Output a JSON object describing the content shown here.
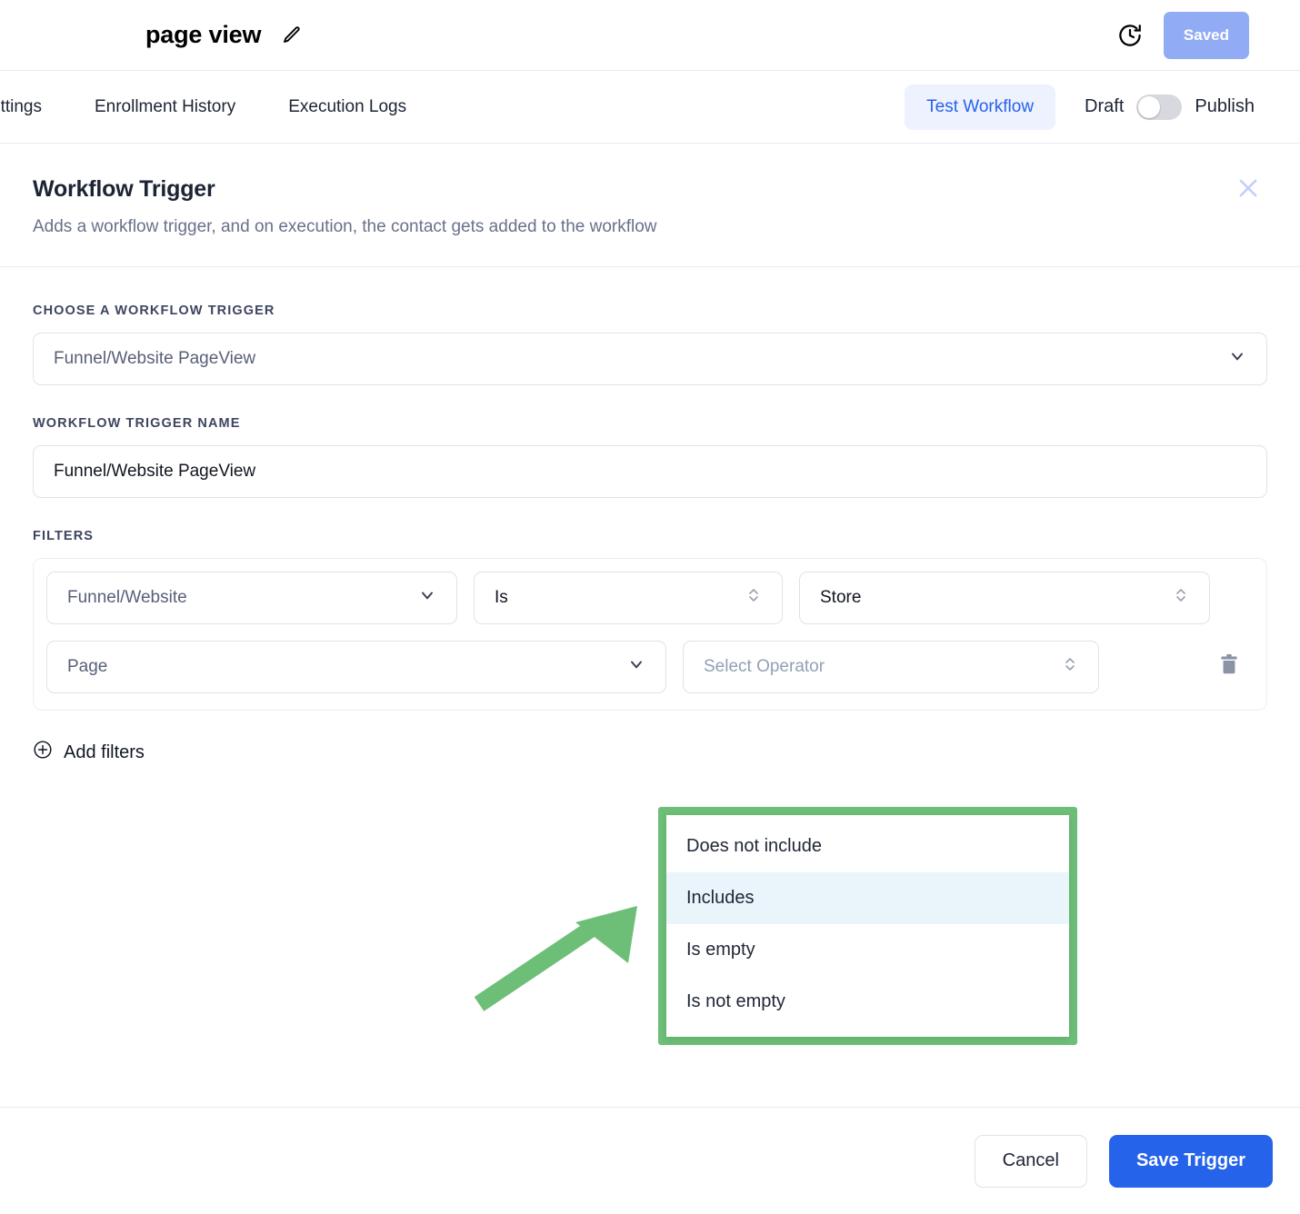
{
  "topbar": {
    "doc_title": "page view",
    "edit_icon": "pencil-icon",
    "history_icon": "clock-history-icon",
    "saved_label": "Saved"
  },
  "tabbar": {
    "tabs": [
      {
        "label": "ettings"
      },
      {
        "label": "Enrollment History"
      },
      {
        "label": "Execution Logs"
      }
    ],
    "test_workflow_label": "Test Workflow",
    "draft_label": "Draft",
    "publish_label": "Publish",
    "toggle_state": "draft"
  },
  "panel": {
    "title": "Workflow Trigger",
    "subtitle": "Adds a workflow trigger, and on execution, the contact gets added to the workflow",
    "close_icon": "close-icon"
  },
  "form": {
    "choose_trigger_label": "CHOOSE A WORKFLOW TRIGGER",
    "choose_trigger_value": "Funnel/Website PageView",
    "trigger_name_label": "WORKFLOW TRIGGER NAME",
    "trigger_name_value": "Funnel/Website PageView",
    "filters_label": "FILTERS",
    "filters": [
      {
        "field": "Funnel/Website",
        "operator": "Is",
        "value": "Store"
      },
      {
        "field": "Page",
        "operator_placeholder": "Select Operator"
      }
    ],
    "add_filters_label": "Add filters",
    "add_filters_icon": "plus-circle-icon",
    "delete_icon": "trash-icon"
  },
  "operator_dropdown": {
    "options": [
      {
        "label": "Does not include",
        "selected": false
      },
      {
        "label": "Includes",
        "selected": true
      },
      {
        "label": "Is empty",
        "selected": false
      },
      {
        "label": "Is not empty",
        "selected": false
      }
    ]
  },
  "footer": {
    "cancel_label": "Cancel",
    "save_label": "Save Trigger"
  },
  "colors": {
    "accent_blue": "#2563eb",
    "saved_button": "#92abf5",
    "annotation_green": "#6dbf78",
    "highlight_row": "#eaf4fb"
  }
}
